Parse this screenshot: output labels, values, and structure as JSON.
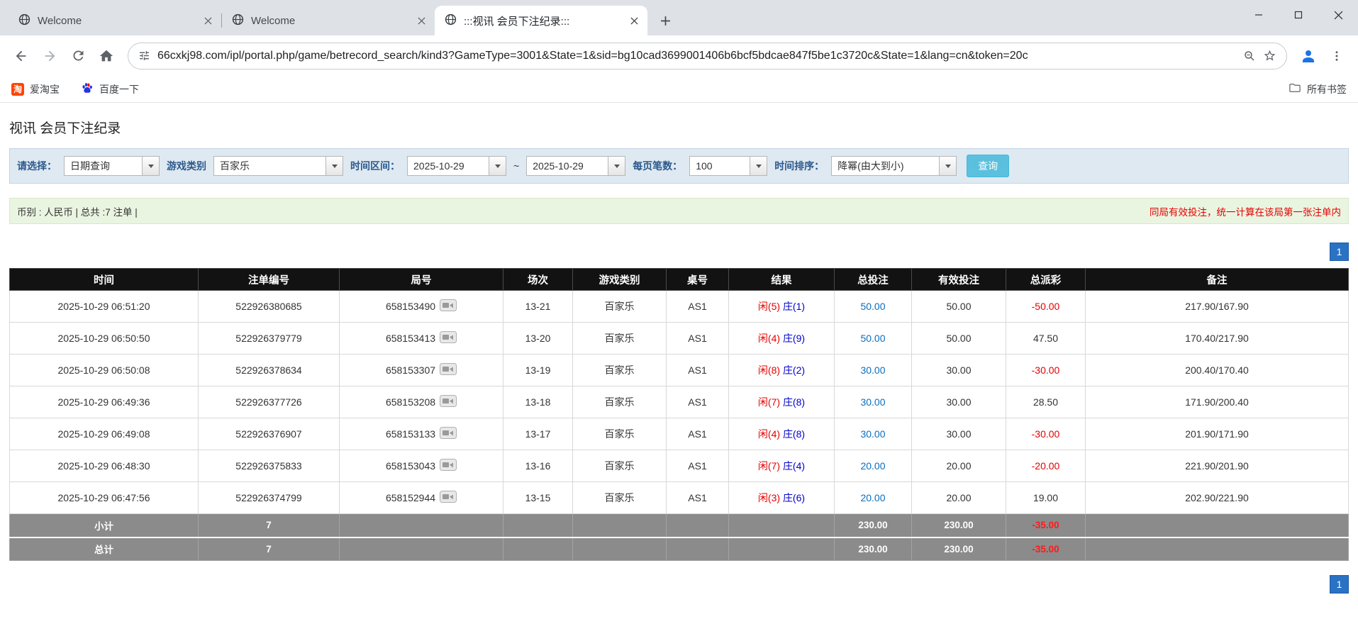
{
  "colors": {
    "player_red": "#e60000",
    "banker_blue": "#0000cc",
    "bet_link_blue": "#0a6ebd",
    "negative_red": "#e80000",
    "notice_red": "#e60000",
    "pager_blue": "#2a72c3",
    "search_button_blue": "#5bc0de",
    "table_header_bg": "#121212",
    "summary_row_bg": "#8b8b8b",
    "filter_bar_bg": "#dfe9f2",
    "info_bar_bg": "#eaf5e1"
  },
  "browser": {
    "tabs": [
      {
        "title": "Welcome"
      },
      {
        "title": "Welcome"
      },
      {
        "title": ":::视讯 会员下注纪录:::"
      }
    ],
    "url": "66cxkj98.com/ipl/portal.php/game/betrecord_search/kind3?GameType=3001&State=1&sid=bg10cad3699001406b6bcf5bdcae847f5be1c3720c&State=1&lang=cn&token=20c",
    "bookmarks": {
      "taobao": "爱淘宝",
      "taobao_icon_glyph": "淘",
      "baidu": "百度一下",
      "all_bookmarks": "所有书签"
    }
  },
  "page": {
    "title": "视讯 会员下注纪录",
    "filters": {
      "select_label": "请选择：",
      "query_type_value": "日期查询",
      "game_type_label": "游戏类别",
      "game_type_value": "百家乐",
      "time_range_label": "时间区间：",
      "date_from": "2025-10-29",
      "range_separator": "~",
      "date_to": "2025-10-29",
      "per_page_label": "每页笔数：",
      "per_page_value": "100",
      "sort_label": "时间排序：",
      "sort_value": "降幂(由大到小)",
      "search_button": "查询"
    },
    "info_bar": {
      "summary": "币别 : 人民币 | 总共 :7 注单 |",
      "notice": "同局有效投注，统一计算在该局第一张注单内"
    },
    "pagination": {
      "current_page": "1"
    },
    "table": {
      "headers": [
        "时间",
        "注单编号",
        "局号",
        "场次",
        "游戏类别",
        "桌号",
        "结果",
        "总投注",
        "有效投注",
        "总派彩",
        "备注"
      ],
      "rows": [
        {
          "time": "2025-10-29 06:51:20",
          "bet_id": "522926380685",
          "round": "658153490",
          "session": "13-21",
          "game": "百家乐",
          "table_no": "AS1",
          "result_player": "闲(5)",
          "result_banker": "庄(1)",
          "total_bet": "50.00",
          "valid_bet": "50.00",
          "payout": "-50.00",
          "note": "217.90/167.90"
        },
        {
          "time": "2025-10-29 06:50:50",
          "bet_id": "522926379779",
          "round": "658153413",
          "session": "13-20",
          "game": "百家乐",
          "table_no": "AS1",
          "result_player": "闲(4)",
          "result_banker": "庄(9)",
          "total_bet": "50.00",
          "valid_bet": "50.00",
          "payout": "47.50",
          "note": "170.40/217.90"
        },
        {
          "time": "2025-10-29 06:50:08",
          "bet_id": "522926378634",
          "round": "658153307",
          "session": "13-19",
          "game": "百家乐",
          "table_no": "AS1",
          "result_player": "闲(8)",
          "result_banker": "庄(2)",
          "total_bet": "30.00",
          "valid_bet": "30.00",
          "payout": "-30.00",
          "note": "200.40/170.40"
        },
        {
          "time": "2025-10-29 06:49:36",
          "bet_id": "522926377726",
          "round": "658153208",
          "session": "13-18",
          "game": "百家乐",
          "table_no": "AS1",
          "result_player": "闲(7)",
          "result_banker": "庄(8)",
          "total_bet": "30.00",
          "valid_bet": "30.00",
          "payout": "28.50",
          "note": "171.90/200.40"
        },
        {
          "time": "2025-10-29 06:49:08",
          "bet_id": "522926376907",
          "round": "658153133",
          "session": "13-17",
          "game": "百家乐",
          "table_no": "AS1",
          "result_player": "闲(4)",
          "result_banker": "庄(8)",
          "total_bet": "30.00",
          "valid_bet": "30.00",
          "payout": "-30.00",
          "note": "201.90/171.90"
        },
        {
          "time": "2025-10-29 06:48:30",
          "bet_id": "522926375833",
          "round": "658153043",
          "session": "13-16",
          "game": "百家乐",
          "table_no": "AS1",
          "result_player": "闲(7)",
          "result_banker": "庄(4)",
          "total_bet": "20.00",
          "valid_bet": "20.00",
          "payout": "-20.00",
          "note": "221.90/201.90"
        },
        {
          "time": "2025-10-29 06:47:56",
          "bet_id": "522926374799",
          "round": "658152944",
          "session": "13-15",
          "game": "百家乐",
          "table_no": "AS1",
          "result_player": "闲(3)",
          "result_banker": "庄(6)",
          "total_bet": "20.00",
          "valid_bet": "20.00",
          "payout": "19.00",
          "note": "202.90/221.90"
        }
      ],
      "subtotal": {
        "label": "小计",
        "count": "7",
        "total_bet": "230.00",
        "valid_bet": "230.00",
        "payout": "-35.00"
      },
      "total": {
        "label": "总计",
        "count": "7",
        "total_bet": "230.00",
        "valid_bet": "230.00",
        "payout": "-35.00"
      }
    }
  }
}
